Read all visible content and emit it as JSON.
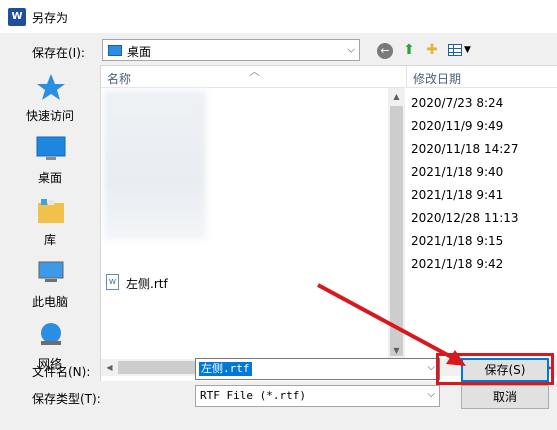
{
  "window": {
    "title": "另存为",
    "app_icon": "W"
  },
  "toolbar": {
    "save_in_label": "保存在(I):",
    "location": "桌面",
    "buttons": [
      "back-icon",
      "up-folder-icon",
      "new-folder-icon",
      "view-menu-icon"
    ]
  },
  "places": [
    {
      "label": "快速访问",
      "icon": "star-icon"
    },
    {
      "label": "桌面",
      "icon": "desktop-icon"
    },
    {
      "label": "库",
      "icon": "library-icon"
    },
    {
      "label": "此电脑",
      "icon": "computer-icon"
    },
    {
      "label": "网络",
      "icon": "network-icon"
    }
  ],
  "file_list": {
    "columns": {
      "name": "名称",
      "date": "修改日期"
    },
    "files": [
      {
        "name": "左侧.rtf"
      }
    ],
    "dates": [
      "2020/7/23 8:24",
      "2020/11/9 9:49",
      "2020/11/18 14:27",
      "2021/1/18 9:40",
      "2021/1/18 9:41",
      "2020/12/28 11:13",
      "2021/1/18 9:15",
      "2021/1/18 9:42"
    ]
  },
  "form": {
    "filename_label": "文件名(N):",
    "filename_value": "左侧.rtf",
    "filetype_label": "保存类型(T):",
    "filetype_value": "RTF File (*.rtf)",
    "save_button": "保存(S)",
    "cancel_button": "取消"
  },
  "colors": {
    "accent": "#0078d7",
    "annotation": "#d8181f",
    "dialog_bg": "#f0f0f0"
  }
}
